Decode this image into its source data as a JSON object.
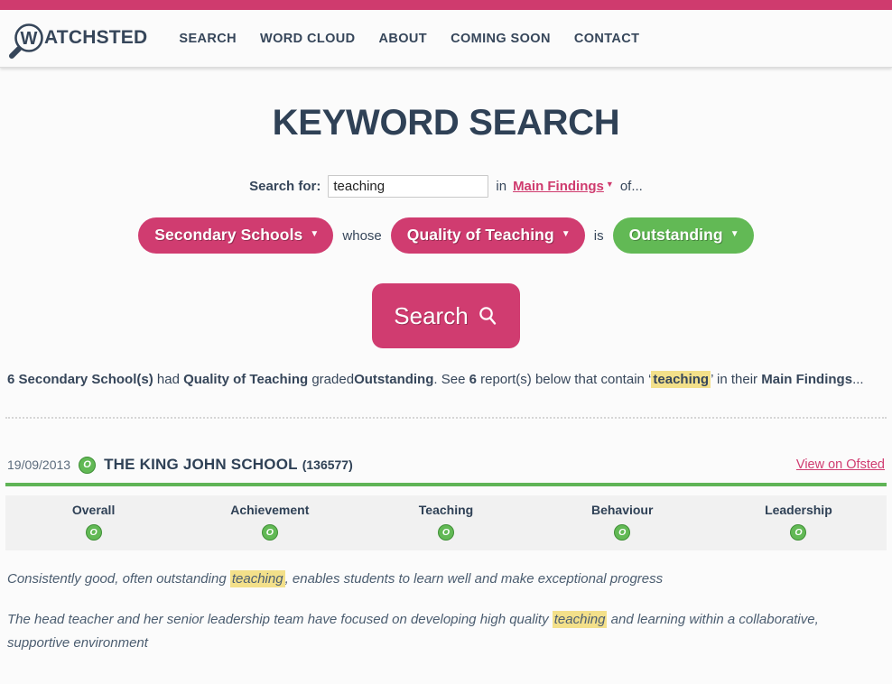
{
  "brand": {
    "logo_mark": "magnifier-w-icon",
    "logo_letter": "W",
    "logo_text": "ATCHSTED"
  },
  "nav": {
    "items": [
      {
        "label": "SEARCH"
      },
      {
        "label": "WORD CLOUD"
      },
      {
        "label": "ABOUT"
      },
      {
        "label": "COMING SOON"
      },
      {
        "label": "CONTACT"
      }
    ]
  },
  "page": {
    "title": "KEYWORD SEARCH"
  },
  "search": {
    "label": "Search for:",
    "keyword_value": "teaching",
    "keyword_placeholder": "",
    "in_word": "in",
    "scope_link": "Main Findings",
    "scope_caret": "▼",
    "of_word": "of...",
    "button_label": "Search",
    "button_icon": "search-icon"
  },
  "filters": {
    "phase": {
      "label": "Secondary Schools",
      "caret": "▼",
      "color": "#d03c70"
    },
    "joiner_1": "whose",
    "category": {
      "label": "Quality of Teaching",
      "caret": "▼",
      "color": "#d03c70"
    },
    "joiner_2": "is",
    "grade": {
      "label": "Outstanding",
      "caret": "▼",
      "color": "#62b955"
    }
  },
  "summary": {
    "count": "6",
    "phase_label": "Secondary School(s)",
    "had": "had",
    "category_label": "Quality of Teaching",
    "graded": "graded",
    "grade_label": "Outstanding",
    "see": ". See",
    "report_count": "6",
    "reports_text": "report(s) below that contain",
    "quote_open": "‘",
    "keyword": "teaching",
    "quote_close": "’",
    "in_their": "in their",
    "scope_label": "Main Findings",
    "ellipsis": "..."
  },
  "result": {
    "date": "19/09/2013",
    "overall_badge": "O",
    "school_name": "THE KING JOHN SCHOOL",
    "urn": "(136577)",
    "ofsted_link": "View on Ofsted",
    "grades": [
      {
        "label": "Overall",
        "badge": "O"
      },
      {
        "label": "Achievement",
        "badge": "O"
      },
      {
        "label": "Teaching",
        "badge": "O"
      },
      {
        "label": "Behaviour",
        "badge": "O"
      },
      {
        "label": "Leadership",
        "badge": "O"
      }
    ],
    "excerpts": [
      {
        "pre": "Consistently good, often outstanding ",
        "hl": "teaching",
        "post": ", enables students to learn well and make exceptional progress"
      },
      {
        "pre": "The head teacher and her senior leadership team have focused on developing high quality ",
        "hl": "teaching",
        "post": " and learning within a collaborative, supportive environment"
      }
    ]
  },
  "colors": {
    "accent_pink": "#cf3b6e",
    "accent_green": "#62b955",
    "text_navy": "#2f4156",
    "highlight_yellow": "#f3e08a"
  }
}
